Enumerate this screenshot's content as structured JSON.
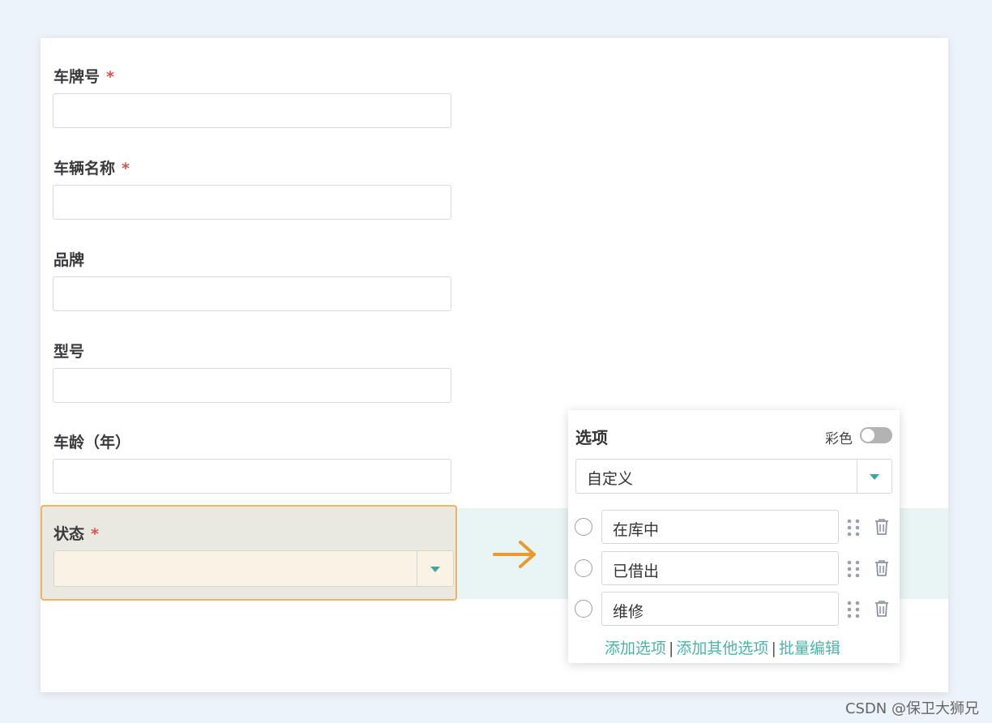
{
  "form": {
    "fields": [
      {
        "label": "车牌号",
        "required_mark": "*",
        "value": ""
      },
      {
        "label": "车辆名称",
        "required_mark": "*",
        "value": ""
      },
      {
        "label": "品牌",
        "value": ""
      },
      {
        "label": "型号",
        "value": ""
      },
      {
        "label": "车龄（年）",
        "value": ""
      }
    ],
    "status_field": {
      "label": "状态",
      "required_mark": "*",
      "value": ""
    }
  },
  "options_panel": {
    "title": "选项",
    "color_label": "彩色",
    "color_enabled": false,
    "type_value": "自定义",
    "options": [
      {
        "label": "在库中"
      },
      {
        "label": "已借出"
      },
      {
        "label": "维修"
      }
    ],
    "links": {
      "add_option": "添加选项",
      "add_other_option": "添加其他选项",
      "batch_edit": "批量编辑",
      "separator": "|"
    }
  },
  "icons": {
    "arrow": "arrow-right-icon",
    "caret": "caret-down-icon",
    "drag": "drag-handle-icon",
    "delete": "trash-icon"
  },
  "colors": {
    "accent": "#49b5aa",
    "required": "#d9534f",
    "highlight_border": "#f0b45c",
    "arrow": "#e89a2e"
  },
  "watermark": "CSDN @保卫大狮兄"
}
